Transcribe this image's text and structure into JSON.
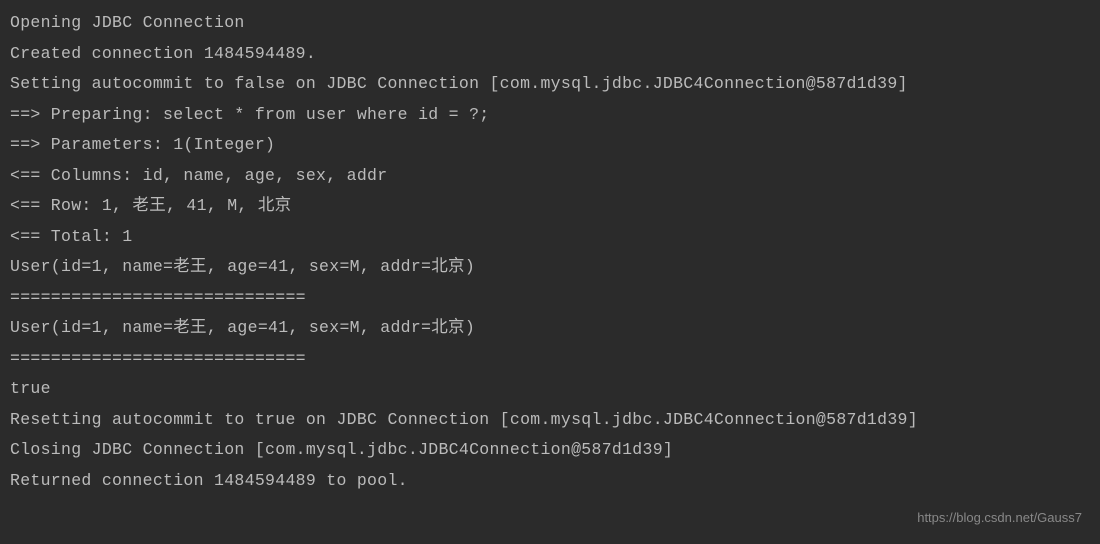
{
  "log": {
    "lines": [
      "Opening JDBC Connection",
      "Created connection 1484594489.",
      "Setting autocommit to false on JDBC Connection [com.mysql.jdbc.JDBC4Connection@587d1d39]",
      "==>  Preparing: select * from user where id = ?;",
      "==> Parameters: 1(Integer)",
      "<==    Columns: id, name, age, sex, addr",
      "<==        Row: 1, 老王, 41, M, 北京",
      "<==      Total: 1",
      "User(id=1, name=老王, age=41, sex=M, addr=北京)",
      "=============================",
      "User(id=1, name=老王, age=41, sex=M, addr=北京)",
      "=============================",
      "true",
      "Resetting autocommit to true on JDBC Connection [com.mysql.jdbc.JDBC4Connection@587d1d39]",
      "Closing JDBC Connection [com.mysql.jdbc.JDBC4Connection@587d1d39]",
      "Returned connection 1484594489 to pool."
    ]
  },
  "watermark": "https://blog.csdn.net/Gauss7"
}
